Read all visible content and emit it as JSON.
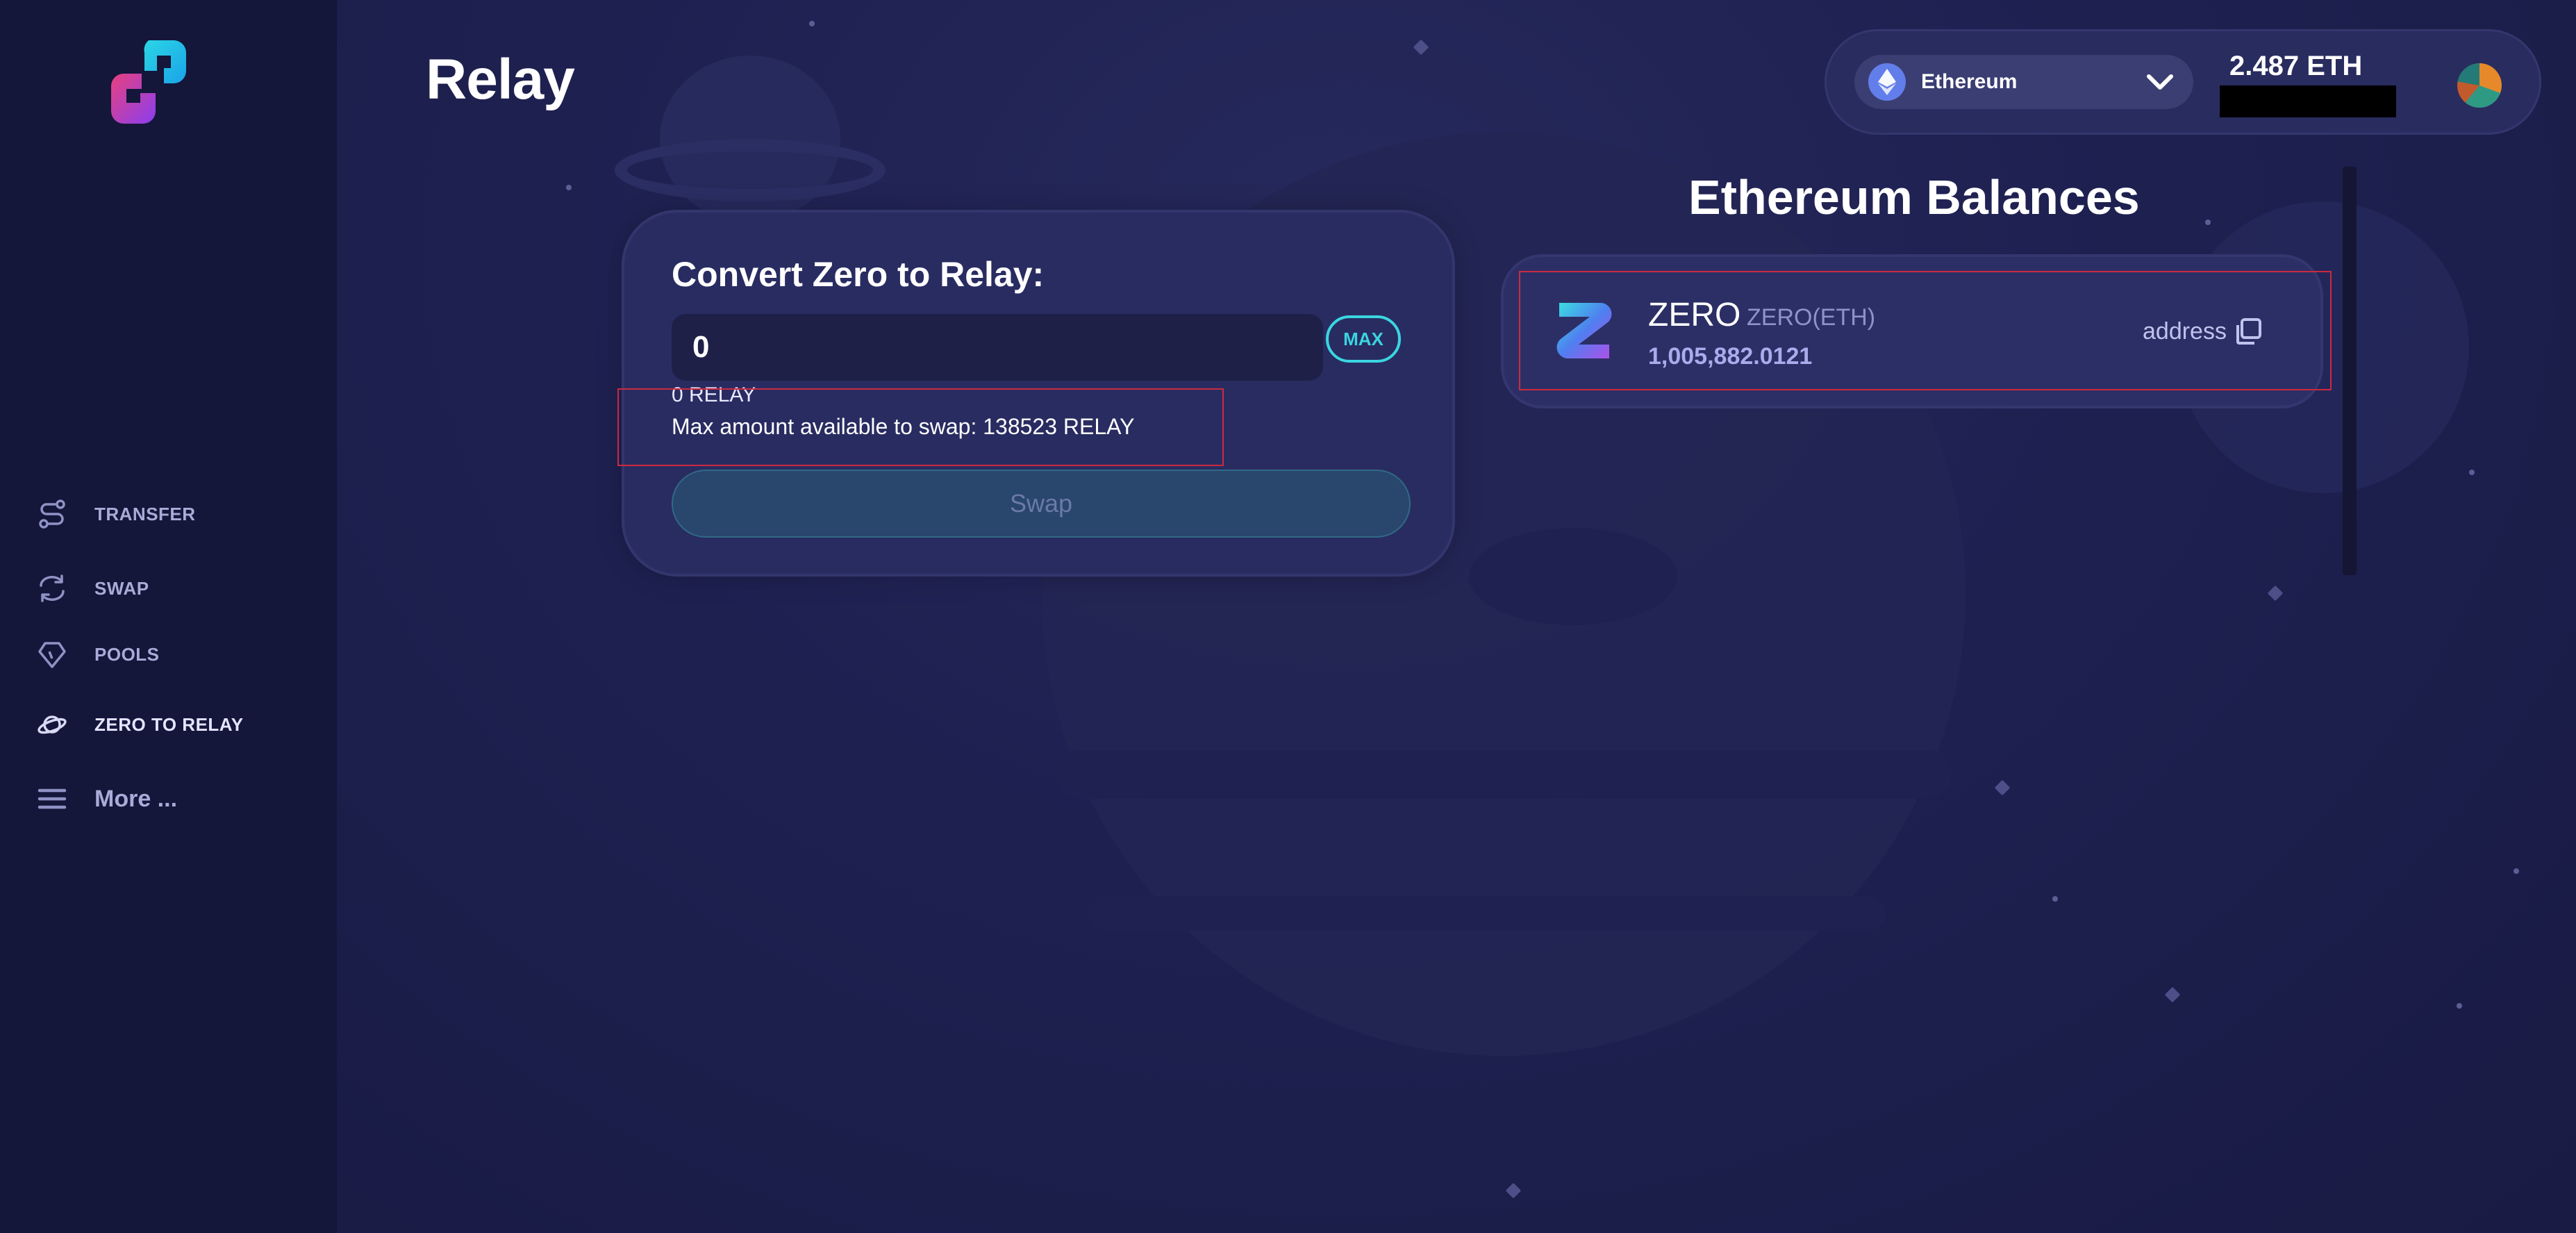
{
  "app": {
    "title": "Relay"
  },
  "sidebar": {
    "logo_icon": "relay-logo-icon",
    "items": [
      {
        "label": "TRANSFER",
        "icon": "transfer-route-icon"
      },
      {
        "label": "SWAP",
        "icon": "swap-arrows-icon"
      },
      {
        "label": "POOLS",
        "icon": "diamond-icon"
      },
      {
        "label": "ZERO TO RELAY",
        "icon": "planet-icon",
        "active": true
      },
      {
        "label": "More ...",
        "icon": "hamburger-menu-icon"
      }
    ]
  },
  "header": {
    "network": {
      "label": "Ethereum",
      "icon": "ethereum-icon",
      "icon_color": "#627eea"
    },
    "balance": "2.487 ETH"
  },
  "convert": {
    "title": "Convert Zero to Relay:",
    "input_value": "0",
    "max_label": "MAX",
    "relay_estimate": "0 RELAY",
    "max_available": "Max amount available to swap: 138523 RELAY",
    "swap_label": "Swap",
    "accent_color": "#3ad6e0"
  },
  "balances": {
    "title": "Ethereum Balances",
    "tokens": [
      {
        "symbol": "ZERO",
        "chain": "ZERO(ETH)",
        "amount": "1,005,882.0121",
        "address_label": "address",
        "icon": "zero-token-icon"
      }
    ]
  }
}
